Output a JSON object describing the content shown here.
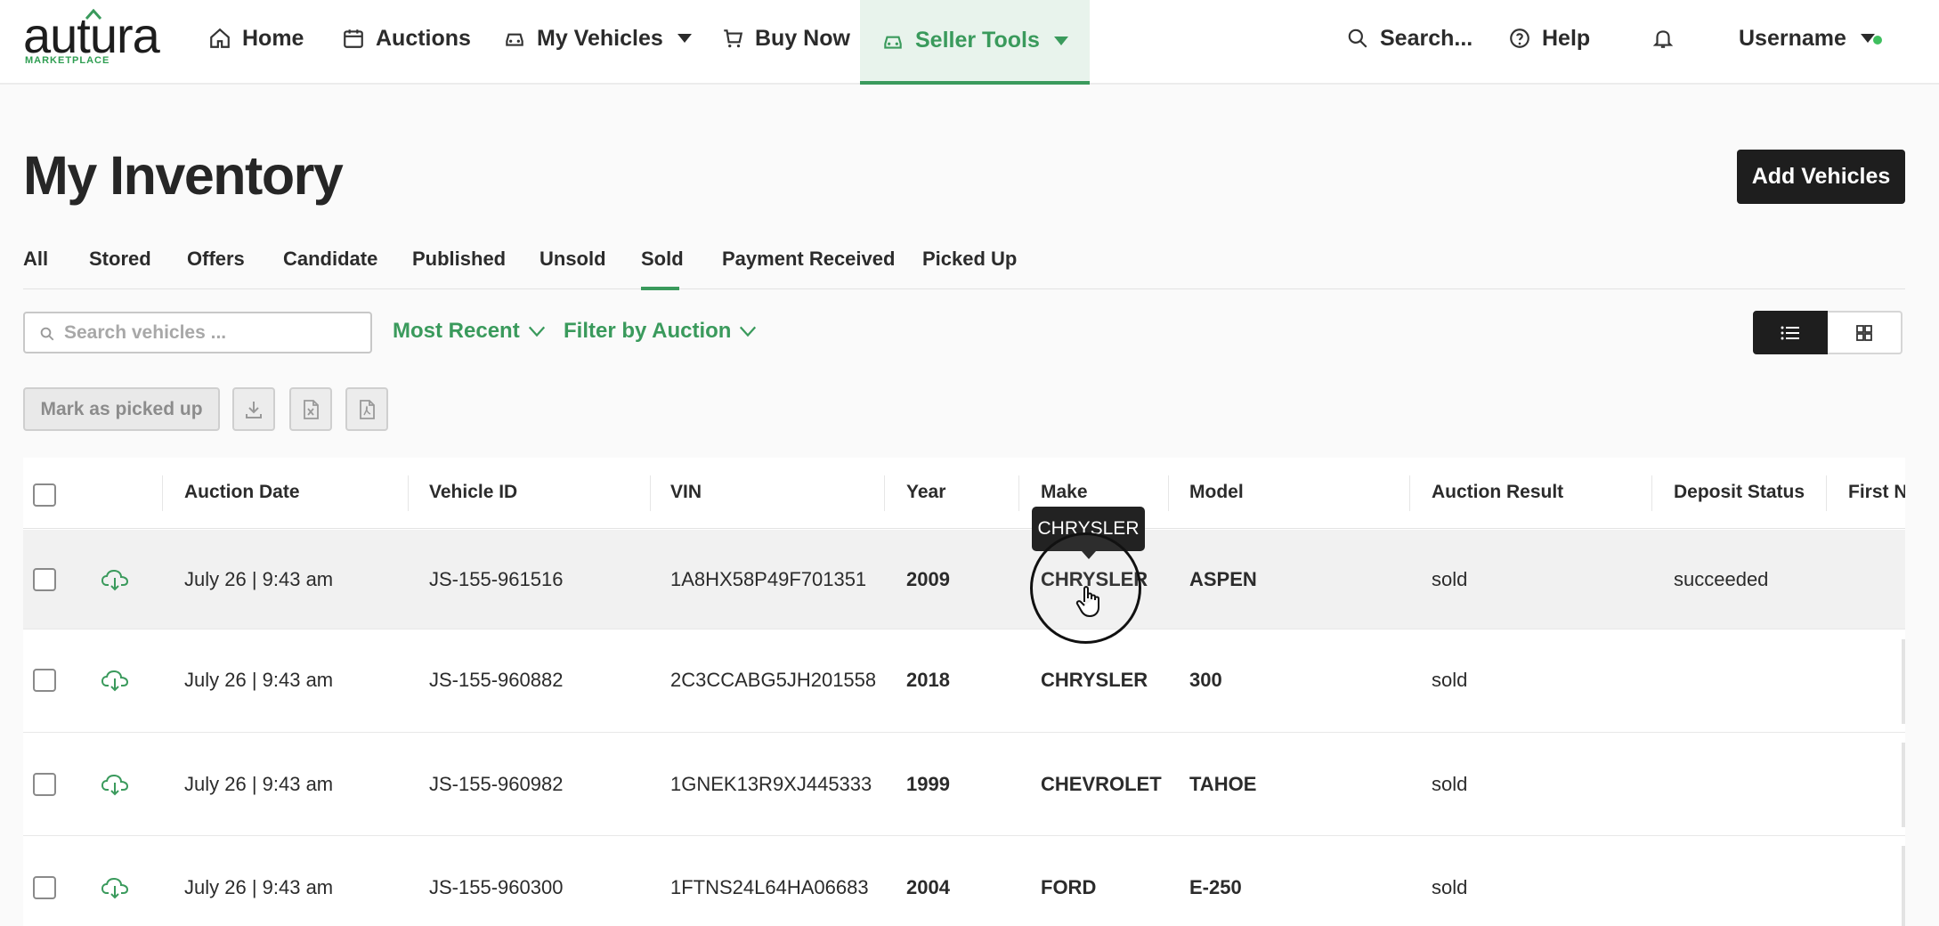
{
  "brand": {
    "name": "autura",
    "sub": "MARKETPLACE",
    "accent": "#3a9a5c"
  },
  "nav": {
    "home": "Home",
    "auctions": "Auctions",
    "my_vehicles": "My Vehicles",
    "buy_now": "Buy Now",
    "seller_tools": "Seller Tools",
    "search": "Search...",
    "help": "Help",
    "username": "Username"
  },
  "page": {
    "title": "My Inventory",
    "add_button": "Add Vehicles"
  },
  "tabs": [
    "All",
    "Stored",
    "Offers",
    "Candidate",
    "Published",
    "Unsold",
    "Sold",
    "Payment Received",
    "Picked Up"
  ],
  "active_tab": "Sold",
  "filters": {
    "search_placeholder": "Search vehicles ...",
    "sort": "Most Recent",
    "auction_filter": "Filter by Auction"
  },
  "actions": {
    "mark_picked_up": "Mark as picked up"
  },
  "table": {
    "columns": [
      "Auction Date",
      "Vehicle ID",
      "VIN",
      "Year",
      "Make",
      "Model",
      "Auction Result",
      "Deposit Status",
      "First N"
    ],
    "rows": [
      {
        "date": "July 26 | 9:43 am",
        "vehicle_id": "JS-155-961516",
        "vin": "1A8HX58P49F701351",
        "year": "2009",
        "make": "CHRYSLER",
        "model": "ASPEN",
        "result": "sold",
        "deposit": "succeeded"
      },
      {
        "date": "July 26 | 9:43 am",
        "vehicle_id": "JS-155-960882",
        "vin": "2C3CCABG5JH201558",
        "year": "2018",
        "make": "CHRYSLER",
        "model": "300",
        "result": "sold",
        "deposit": ""
      },
      {
        "date": "July 26 | 9:43 am",
        "vehicle_id": "JS-155-960982",
        "vin": "1GNEK13R9XJ445333",
        "year": "1999",
        "make": "CHEVROLET",
        "model": "TAHOE",
        "result": "sold",
        "deposit": ""
      },
      {
        "date": "July 26 | 9:43 am",
        "vehicle_id": "JS-155-960300",
        "vin": "1FTNS24L64HA06683",
        "year": "2004",
        "make": "FORD",
        "model": "E-250",
        "result": "sold",
        "deposit": ""
      }
    ]
  },
  "tooltip": "CHRYSLER"
}
